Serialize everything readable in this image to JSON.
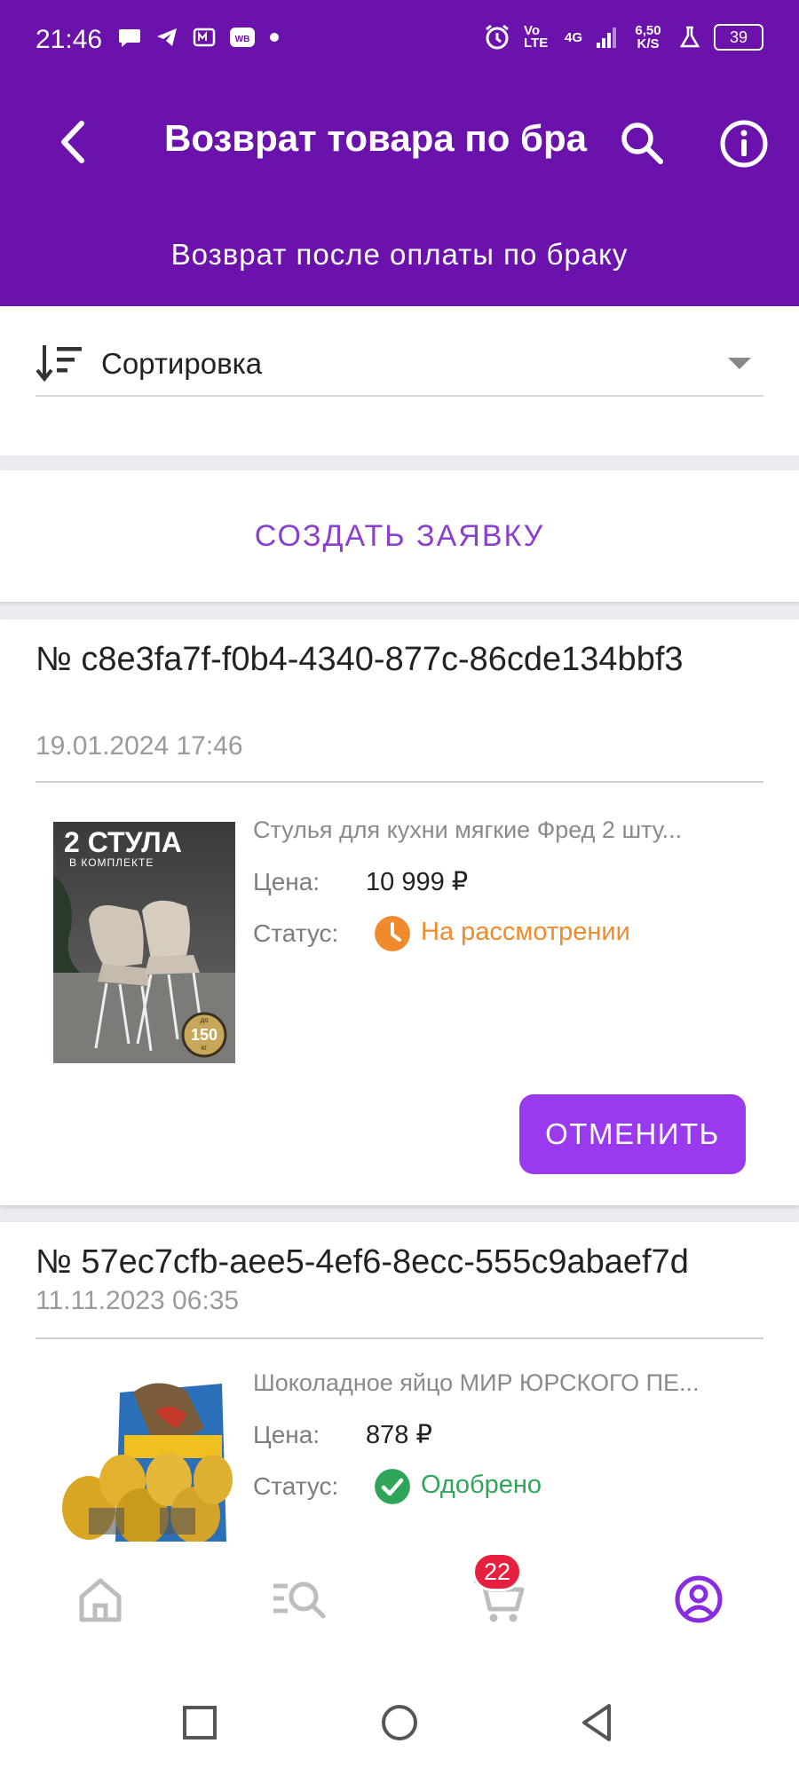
{
  "status_bar": {
    "time": "21:46",
    "network": "4G",
    "volte": "Vo LTE",
    "speed": "6,50 K/S",
    "battery": "39"
  },
  "header": {
    "title": "Возврат товара по бра",
    "subtitle": "Возврат после оплаты по браку"
  },
  "sort": {
    "label": "Сортировка"
  },
  "create_button": "СОЗДАТЬ ЗАЯВКУ",
  "orders": [
    {
      "id": "№ c8e3fa7f-f0b4-4340-877c-86cde134bbf3",
      "date": "19.01.2024 17:46",
      "product_name": "Стулья для кухни мягкие Фред 2 шту...",
      "price_label": "Цена:",
      "price": "10 999 ₽",
      "status_label": "Статус:",
      "status": "На рассмотрении",
      "status_color": "#f08a2c",
      "thumb_text_1": "2 СТУЛА",
      "thumb_text_2": "В КОМПЛЕКТЕ",
      "thumb_badge_small": "до",
      "thumb_badge": "150",
      "thumb_badge_unit": "кг",
      "cancel": "ОТМЕНИТЬ"
    },
    {
      "id": "№ 57ec7cfb-aee5-4ef6-8ecc-555c9abaef7d",
      "date": "11.11.2023 06:35",
      "product_name": "Шоколадное яйцо МИР ЮРСКОГО ПЕ...",
      "price_label": "Цена:",
      "price": "878 ₽",
      "status_label": "Статус:",
      "status": "Одобрено",
      "status_color": "#2fa55a"
    }
  ],
  "bottom_nav": {
    "cart_badge": "22",
    "icons": [
      "home-icon",
      "catalog-search-icon",
      "cart-icon",
      "profile-icon"
    ],
    "active_color": "#8a2be2"
  },
  "colors": {
    "brand": "#6b12ac",
    "accent": "#9a3aee"
  }
}
